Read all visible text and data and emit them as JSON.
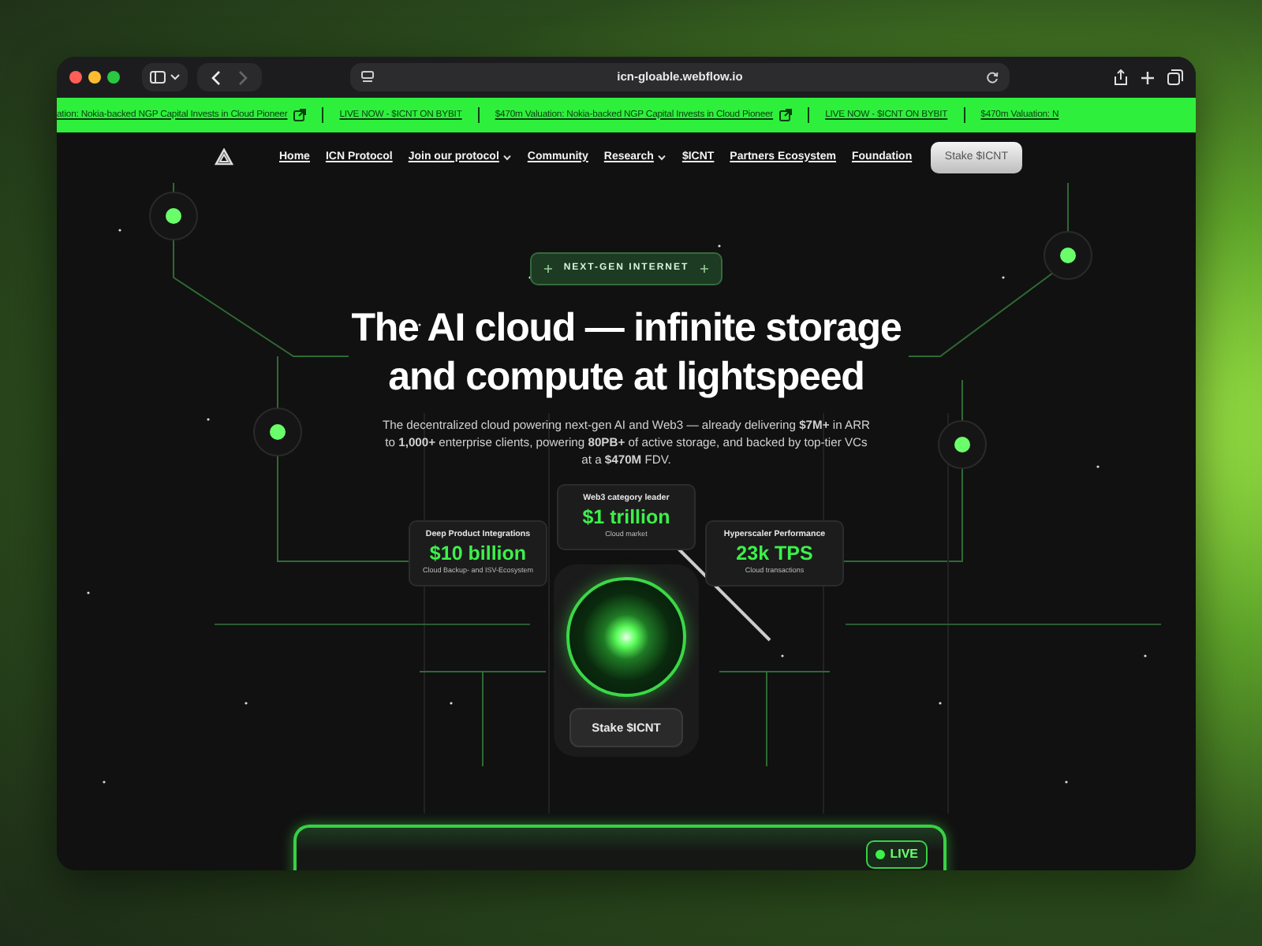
{
  "browser": {
    "url": "icn-gloable.webflow.io",
    "nav_buttons": [
      {
        "kind": "back",
        "disabled": false
      },
      {
        "kind": "forward",
        "disabled": true
      }
    ]
  },
  "ticker": [
    {
      "text": "ation: Nokia-backed NGP Capital Invests in Cloud Pioneer",
      "external": true
    },
    {
      "text": "LIVE NOW - $ICNT ON BYBIT",
      "external": false
    },
    {
      "text": "$470m Valuation: Nokia-backed NGP Capital Invests in Cloud Pioneer",
      "external": true
    },
    {
      "text": "LIVE NOW - $ICNT ON BYBIT",
      "external": false
    },
    {
      "text": "$470m Valuation: N",
      "external": false
    }
  ],
  "nav": {
    "items": [
      {
        "label": "Home",
        "dropdown": false
      },
      {
        "label": "ICN Protocol",
        "dropdown": false
      },
      {
        "label": "Join our protocol",
        "dropdown": true
      },
      {
        "label": "Community",
        "dropdown": false
      },
      {
        "label": "Research",
        "dropdown": true
      },
      {
        "label": "$ICNT",
        "dropdown": false
      },
      {
        "label": "Partners Ecosystem",
        "dropdown": false
      },
      {
        "label": "Foundation",
        "dropdown": false
      }
    ],
    "cta": "Stake $ICNT"
  },
  "hero": {
    "badge": "NEXT-GEN INTERNET",
    "title_lines": [
      "The AI cloud — infinite storage",
      "and compute at lightspeed"
    ],
    "description": "The decentralized cloud powering next-gen AI and Web3 — already delivering **$7M+** in ARR to **1,000+** enterprise clients, powering **80PB+** of active storage, and backed by top-tier VCs at a **$470M** FDV.",
    "stats": [
      {
        "label": "Deep Product Integrations",
        "value": "$10 billion",
        "caption": "Cloud Backup- and ISV-Ecosystem"
      },
      {
        "label": "Web3 category leader",
        "value": "$1 trillion",
        "caption": "Cloud market"
      },
      {
        "label": "Hyperscaler Performance",
        "value": "23k TPS",
        "caption": "Cloud transactions"
      }
    ],
    "stake_button": "Stake $ICNT"
  },
  "live_panel": {
    "badge": "LIVE"
  }
}
